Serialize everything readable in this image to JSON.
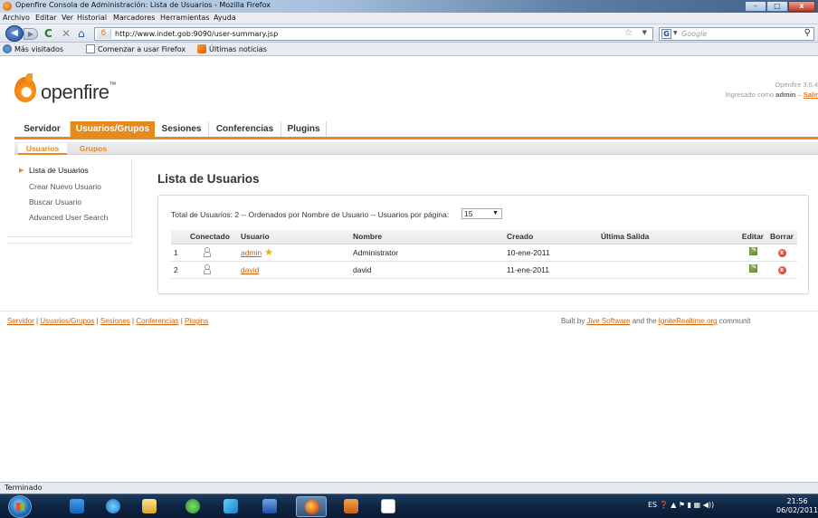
{
  "window": {
    "title": "Openfire Consola de Administración: Lista de Usuarios - Mozilla Firefox",
    "min": "–",
    "max": "□",
    "close": "x"
  },
  "menubar": [
    "Archivo",
    "Editar",
    "Ver",
    "Historial",
    "Marcadores",
    "Herramientas",
    "Ayuda"
  ],
  "navbar": {
    "url": "http://www.indet.gob:9090/user-summary.jsp",
    "search_placeholder": "Google",
    "search_engine": "G"
  },
  "bookmarks": [
    "Más visitados",
    "Comenzar a usar Firefox",
    "Últimas noticias"
  ],
  "header": {
    "logo_text": "openfire",
    "version": "Openfire 3.6.4",
    "logged_as_prefix": "Ingresado como",
    "logged_user": "admin",
    "logout_sep": " – ",
    "logout": "Salir"
  },
  "main_tabs": [
    "Servidor",
    "Usuarios/Grupos",
    "Sesiones",
    "Conferencias",
    "Plugins"
  ],
  "sub_tabs": [
    "Usuarios",
    "Grupos"
  ],
  "sidebar": [
    "Lista de Usuarios",
    "Crear Nuevo Usuario",
    "Buscar Usuario",
    "Advanced User Search"
  ],
  "content": {
    "title": "Lista de Usuarios",
    "summary": "Total de Usuarios: 2 -- Ordenados por Nombre de Usuario -- Usuarios por página:",
    "per_page": "15",
    "columns": [
      "Conectado",
      "Usuario",
      "Nombre",
      "Creado",
      "Última Salida",
      "Editar",
      "Borrar"
    ],
    "rows": [
      {
        "num": "1",
        "user": "admin",
        "name": "Administrator",
        "created": "10-ene-2011",
        "last": ""
      },
      {
        "num": "2",
        "user": "david",
        "name": "david",
        "created": "11-ene-2011",
        "last": ""
      }
    ]
  },
  "footer": {
    "links": [
      "Servidor",
      "Usuarios/Grupos",
      "Sesiones",
      "Conferencias",
      "Plugins"
    ],
    "credit_prefix": "Built by ",
    "credit_link1": "Jive Software",
    "credit_mid": " and the ",
    "credit_link2": "IgniteRealtime.org",
    "credit_suffix": " communit"
  },
  "status": "Terminado",
  "taskbar": {
    "lang": "ES",
    "time": "21:56",
    "date": "06/02/2011"
  },
  "colors": {
    "accent": "#e48a1e",
    "link": "#d2620a"
  }
}
